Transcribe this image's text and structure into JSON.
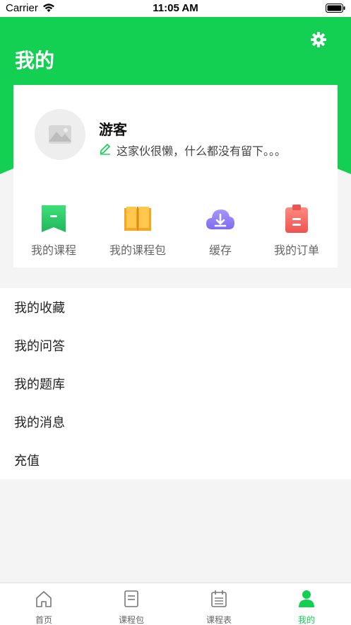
{
  "status_bar": {
    "carrier": "Carrier",
    "time": "11:05 AM"
  },
  "header": {
    "title": "我的",
    "settings_icon": "gear-icon"
  },
  "profile": {
    "name": "游客",
    "signature": "这家伙很懒，什么都没有留下。。。",
    "avatar_icon": "image-placeholder-icon",
    "edit_icon": "pencil-icon"
  },
  "quick_actions": [
    {
      "label": "我的课程",
      "icon": "bookmark-icon",
      "color": "#2ecc71"
    },
    {
      "label": "我的课程包",
      "icon": "book-icon",
      "color": "#f5a623"
    },
    {
      "label": "缓存",
      "icon": "cloud-download-icon",
      "color": "#8b7cf6"
    },
    {
      "label": "我的订单",
      "icon": "clipboard-icon",
      "color": "#f0605a"
    }
  ],
  "menu": [
    {
      "label": "我的收藏"
    },
    {
      "label": "我的问答"
    },
    {
      "label": "我的题库"
    },
    {
      "label": "我的消息"
    },
    {
      "label": "充值"
    }
  ],
  "tabs": [
    {
      "label": "首页",
      "icon": "home-icon",
      "active": false
    },
    {
      "label": "课程包",
      "icon": "book-icon",
      "active": false
    },
    {
      "label": "课程表",
      "icon": "calendar-icon",
      "active": false
    },
    {
      "label": "我的",
      "icon": "user-icon",
      "active": true
    }
  ],
  "colors": {
    "brand_green": "#13cf52",
    "background": "#f4f4f4"
  }
}
